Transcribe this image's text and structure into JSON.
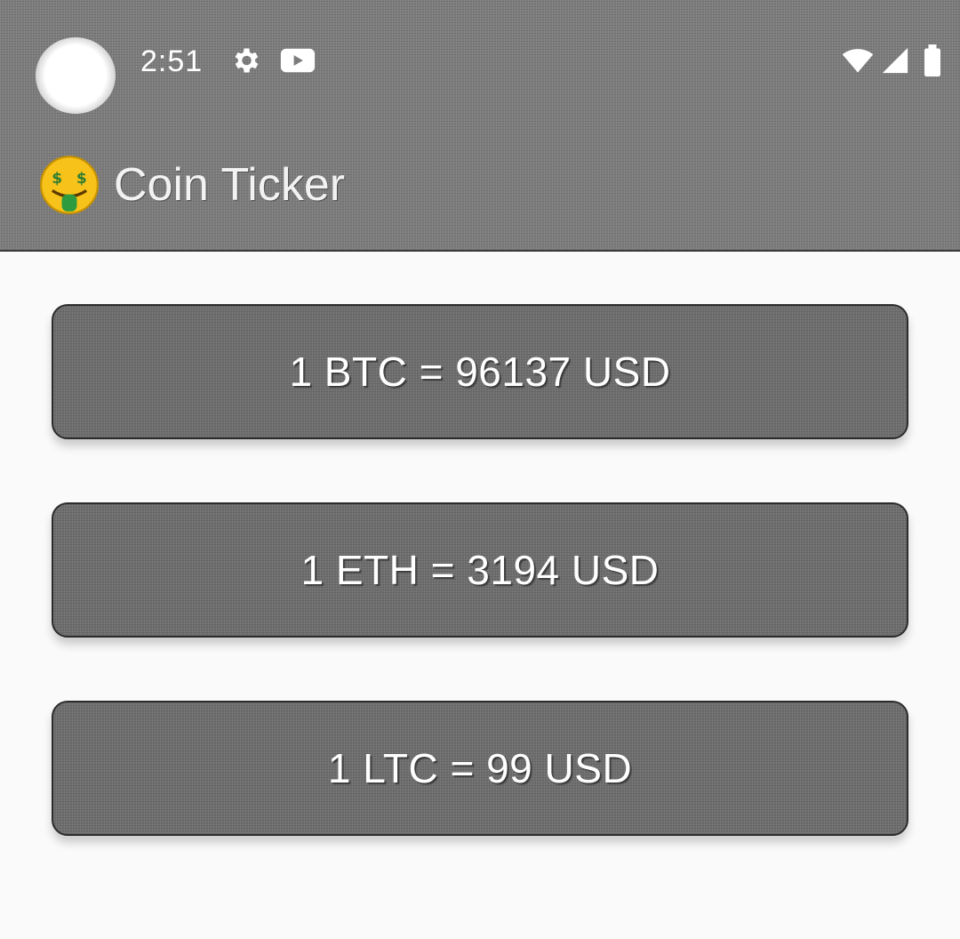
{
  "status_bar": {
    "time": "2:51",
    "icons": [
      "settings-gear-icon",
      "youtube-icon",
      "wifi-icon",
      "cell-signal-icon",
      "battery-icon"
    ]
  },
  "app_bar": {
    "emoji_icon": "money-mouth-face-icon",
    "title": "Coin Ticker"
  },
  "rates": [
    {
      "label": "1 BTC = 96137 USD"
    },
    {
      "label": "1 ETH = 3194 USD"
    },
    {
      "label": "1 LTC = 99 USD"
    }
  ],
  "colors": {
    "app_bar": "#7c7c7c",
    "card": "#6e6e6e",
    "background": "#fafafa",
    "text": "#ffffff"
  }
}
